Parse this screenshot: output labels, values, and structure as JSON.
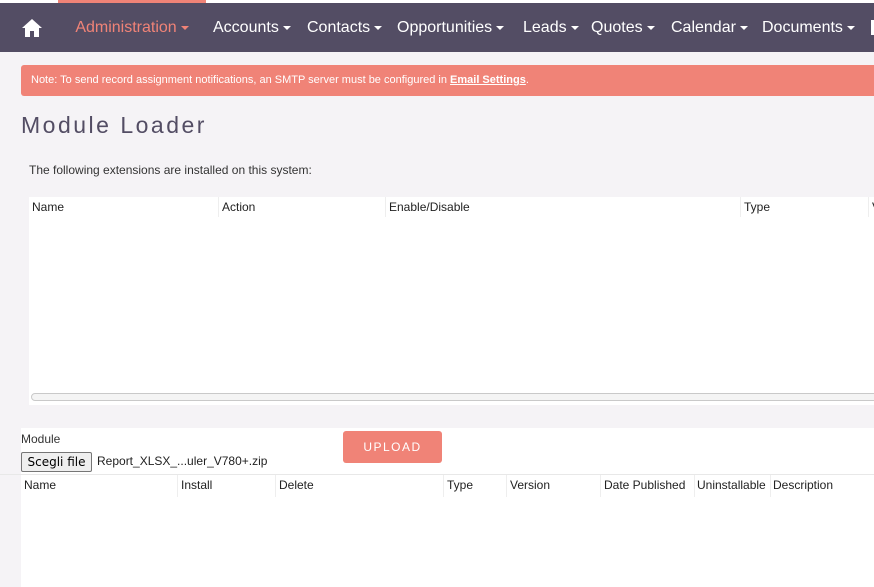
{
  "nav": {
    "home_icon": "home-icon",
    "items": [
      {
        "label": "Administration",
        "active": true
      },
      {
        "label": "Accounts"
      },
      {
        "label": "Contacts"
      },
      {
        "label": "Opportunities"
      },
      {
        "label": "Leads"
      },
      {
        "label": "Quotes"
      },
      {
        "label": "Calendar"
      },
      {
        "label": "Documents"
      }
    ],
    "bg_color": "#534d64",
    "accent_color": "#f08377"
  },
  "note": {
    "text": "Note: To send record assignment notifications, an SMTP server must be configured in ",
    "link_label": "Email Settings",
    "suffix": "."
  },
  "page": {
    "title": "Module Loader",
    "intro": "The following extensions are installed on this system:"
  },
  "installed_table": {
    "columns": [
      "Name",
      "Action",
      "Enable/Disable",
      "Type",
      "V"
    ]
  },
  "upload": {
    "module_label": "Module",
    "file_button_label": "Scegli file",
    "file_name": "Report_XLSX_...uler_V780+.zip",
    "upload_button_label": "UPLOAD"
  },
  "available_table": {
    "columns": [
      "Name",
      "Install",
      "Delete",
      "Type",
      "Version",
      "Date Published",
      "Uninstallable",
      "Description"
    ]
  }
}
